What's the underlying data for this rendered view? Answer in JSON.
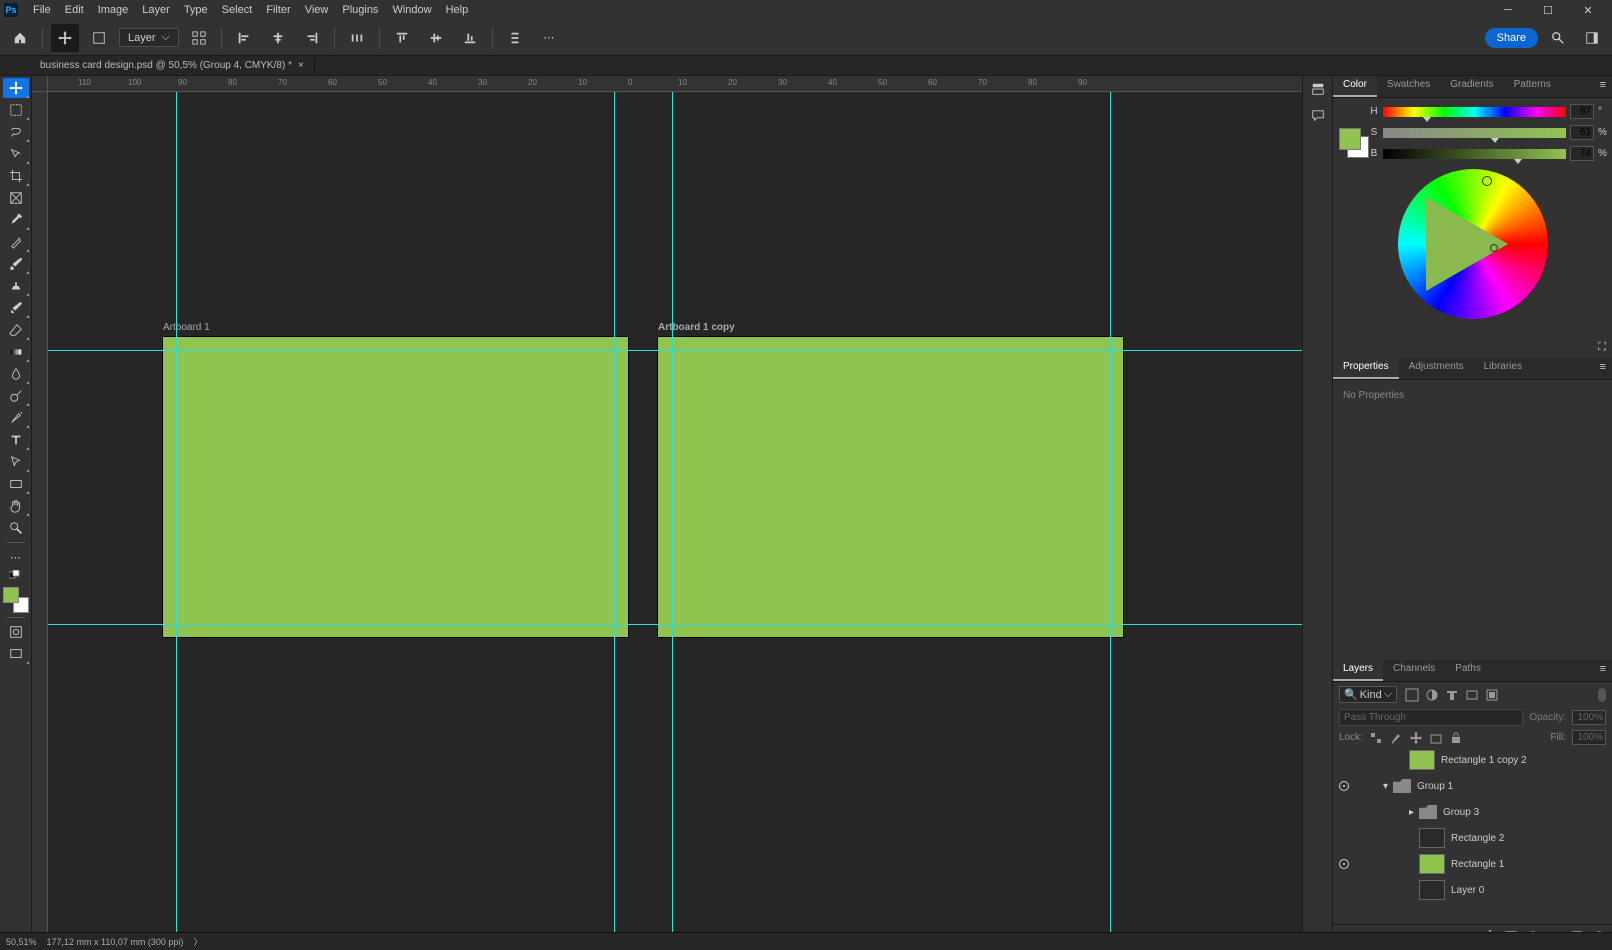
{
  "menu": {
    "items": [
      "File",
      "Edit",
      "Image",
      "Layer",
      "Type",
      "Select",
      "Filter",
      "View",
      "Plugins",
      "Window",
      "Help"
    ]
  },
  "options": {
    "auto_select_label": "Layer",
    "share_label": "Share"
  },
  "document": {
    "tab_title": "business card design.psd @ 50,5% (Group 4, CMYK/8) *"
  },
  "artboards": {
    "a1_label": "Artboard 1",
    "a2_label": "Artboard 1 copy"
  },
  "color_panel": {
    "tabs": [
      "Color",
      "Swatches",
      "Gradients",
      "Patterns"
    ],
    "hsb": {
      "h_label": "H",
      "h_value": "87",
      "h_unit": "°",
      "s_label": "S",
      "s_value": "61",
      "s_unit": "%",
      "b_label": "B",
      "b_value": "74",
      "b_unit": "%"
    }
  },
  "props_panel": {
    "tabs": [
      "Properties",
      "Adjustments",
      "Libraries"
    ],
    "empty_text": "No Properties"
  },
  "layers_panel": {
    "tabs": [
      "Layers",
      "Channels",
      "Paths"
    ],
    "kind_label": "Kind",
    "blend_mode": "Pass Through",
    "opacity_label": "Opacity:",
    "opacity_value": "100%",
    "lock_label": "Lock:",
    "fill_label": "Fill:",
    "fill_value": "100%",
    "rows": [
      {
        "name": "Rectangle 1 copy 2",
        "thumb": "green",
        "indent": 46,
        "vis": false,
        "twisty": ""
      },
      {
        "name": "Group 1",
        "thumb": "folder",
        "indent": 30,
        "vis": true,
        "twisty": "▾"
      },
      {
        "name": "Group 3",
        "thumb": "folder",
        "indent": 56,
        "vis": false,
        "twisty": "▸"
      },
      {
        "name": "Rectangle 2",
        "thumb": "gray",
        "indent": 56,
        "vis": false,
        "twisty": ""
      },
      {
        "name": "Rectangle 1",
        "thumb": "green",
        "indent": 56,
        "vis": true,
        "twisty": ""
      },
      {
        "name": "Layer 0",
        "thumb": "gray",
        "indent": 56,
        "vis": false,
        "twisty": ""
      }
    ]
  },
  "status": {
    "zoom": "50,51%",
    "doc_info": "177,12 mm x 110,07 mm (300 ppi)"
  },
  "ruler_ticks": [
    "110",
    "100",
    "90",
    "80",
    "70",
    "60",
    "50",
    "40",
    "30",
    "20",
    "10",
    "0",
    "10",
    "20",
    "30",
    "40",
    "50",
    "60",
    "70",
    "80",
    "90"
  ]
}
